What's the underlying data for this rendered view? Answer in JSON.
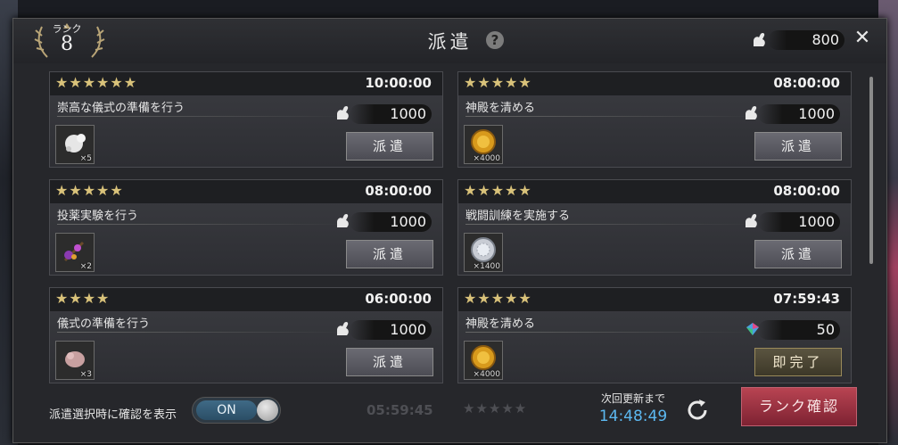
{
  "header": {
    "rank_label": "ランク",
    "rank_value": "8",
    "title": "派遣",
    "help_icon": "?",
    "stamina": "800",
    "close_icon": "✕"
  },
  "missions": [
    {
      "stars": "★★★★★★",
      "time": "10:00:00",
      "name": "崇高な儀式の準備を行う",
      "cost": "1000",
      "cost_icon": "arm-icon",
      "reward_icon": "white-fluff-icon",
      "reward_count": "×5",
      "button": "派遣"
    },
    {
      "stars": "★★★★★",
      "time": "08:00:00",
      "name": "神殿を清める",
      "cost": "1000",
      "cost_icon": "arm-icon",
      "reward_icon": "gold-coin-icon",
      "reward_count": "×4000",
      "button": "派遣"
    },
    {
      "stars": "★★★★★",
      "time": "08:00:00",
      "name": "投薬実験を行う",
      "cost": "1000",
      "cost_icon": "arm-icon",
      "reward_icon": "purple-herb-icon",
      "reward_count": "×2",
      "button": "派遣"
    },
    {
      "stars": "★★★★★",
      "time": "08:00:00",
      "name": "戦闘訓練を実施する",
      "cost": "1000",
      "cost_icon": "arm-icon",
      "reward_icon": "silver-coin-icon",
      "reward_count": "×1400",
      "button": "派遣"
    },
    {
      "stars": "★★★★",
      "time": "06:00:00",
      "name": "儀式の準備を行う",
      "cost": "1000",
      "cost_icon": "arm-icon",
      "reward_icon": "pink-fluff-icon",
      "reward_count": "×3",
      "button": "派遣"
    },
    {
      "stars": "★★★★★",
      "time": "07:59:43",
      "name": "神殿を清める",
      "cost": "50",
      "cost_icon": "gem-icon",
      "reward_icon": "gold-coin-icon",
      "reward_count": "×4000",
      "button": "即完了"
    }
  ],
  "partial_row": {
    "left_time": "05:59:45",
    "right_stars": "★★★★★"
  },
  "footer": {
    "confirm_label": "派遣選択時に確認を表示",
    "toggle_label": "ON",
    "next_update_label": "次回更新まで",
    "next_update_time": "14:48:49",
    "rank_button": "ランク確認"
  },
  "colors": {
    "accent_blue": "#5cb8f0",
    "rank_button": "#a83444",
    "stars": "#d9c27a"
  }
}
